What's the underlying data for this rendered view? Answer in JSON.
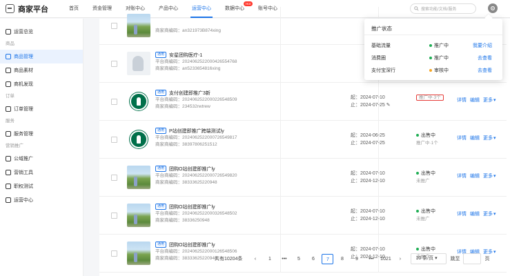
{
  "app": {
    "title": "商家平台"
  },
  "nav": [
    {
      "label": "首页",
      "active": false,
      "badge": ""
    },
    {
      "label": "资金管理",
      "active": false,
      "badge": ""
    },
    {
      "label": "对账中心",
      "active": false,
      "badge": ""
    },
    {
      "label": "产品中心",
      "active": false,
      "badge": ""
    },
    {
      "label": "运营中心",
      "active": true,
      "badge": ""
    },
    {
      "label": "数据中心",
      "active": false,
      "badge": "Hot"
    },
    {
      "label": "账号中心",
      "active": false,
      "badge": ""
    }
  ],
  "search": {
    "placeholder": "搜索功能/文档/服务"
  },
  "sidebar": {
    "items": [
      {
        "type": "item",
        "label": "运营总览",
        "active": false
      },
      {
        "type": "section",
        "label": "商品"
      },
      {
        "type": "item",
        "label": "商品管理",
        "active": true
      },
      {
        "type": "item",
        "label": "商品素材",
        "active": false
      },
      {
        "type": "item",
        "label": "商机发现",
        "active": false
      },
      {
        "type": "section",
        "label": "订单"
      },
      {
        "type": "item",
        "label": "订单管理",
        "active": false
      },
      {
        "type": "section",
        "label": "服务"
      },
      {
        "type": "item",
        "label": "服务管理",
        "active": false
      },
      {
        "type": "section",
        "label": "营销推广"
      },
      {
        "type": "item",
        "label": "公域推广",
        "active": false
      },
      {
        "type": "item",
        "label": "营销工具",
        "active": false
      },
      {
        "type": "item",
        "label": "职权测试",
        "active": false
      },
      {
        "type": "item",
        "label": "运营中心",
        "active": false
      }
    ]
  },
  "products": [
    {
      "img": "photo",
      "tag": "",
      "name": "",
      "id": "",
      "merchant_code": "商家商编码：an321973B874xing",
      "start": "",
      "end": "",
      "status": "",
      "status_sub": "",
      "highlight": false,
      "actions": []
    },
    {
      "img": "white",
      "tag": "通用",
      "name": "安星团购医疗-1",
      "id": "平台商编码：2024062522000426554768",
      "merchant_code": "商家商编码：an5233654816xing",
      "start": "",
      "end": "",
      "status": "",
      "status_sub": "",
      "highlight": false,
      "actions": []
    },
    {
      "img": "logo",
      "tag": "通用",
      "name": "支付创建即推广3新",
      "id": "平台商编码：2024062522000226548509",
      "merchant_code": "商家商编码：234532rwtrew",
      "start": "起：2024-07-10",
      "end": "止：2024-07-25",
      "status": "",
      "status_sub": "推广中·3个",
      "highlight": true,
      "actions": [
        "详情",
        "编辑",
        "更多"
      ]
    },
    {
      "img": "logo",
      "tag": "通用",
      "name": "P站创建即推广跨端测试ly",
      "id": "平台商编码：2024062522000726549817",
      "merchant_code": "商家商编码：38397806251512",
      "start": "起：2024-06-25",
      "end": "止：2024-07-25",
      "status": "出售中",
      "status_sub": "推广中·1个",
      "highlight": false,
      "actions": [
        "详情",
        "编辑",
        "更多"
      ]
    },
    {
      "img": "photo",
      "tag": "通用",
      "name": "团购O站创建即推广ly",
      "id": "平台商编码：2024062522000726549820",
      "merchant_code": "商家商编码：38333625220948",
      "start": "起：2024-07-10",
      "end": "止：2024-12-10",
      "status": "出售中",
      "status_sub": "未推广",
      "highlight": false,
      "actions": [
        "详情",
        "编辑",
        "更多"
      ]
    },
    {
      "img": "photo",
      "tag": "通用",
      "name": "团购O站创建即推广ly",
      "id": "平台商编码：2024062522000326548502",
      "merchant_code": "商家商编码：38336250948",
      "start": "起：2024-07-10",
      "end": "止：2024-12-10",
      "status": "出售中",
      "status_sub": "未推广",
      "highlight": false,
      "actions": [
        "详情",
        "编辑",
        "更多"
      ]
    },
    {
      "img": "photo",
      "tag": "通用",
      "name": "团购O站创建即推广ly",
      "id": "平台商编码：2024062522000126548506",
      "merchant_code": "商家商编码：38333625220948",
      "start": "起：2024-07-10",
      "end": "止：2024-12-10",
      "status": "出售中",
      "status_sub": "未推广",
      "highlight": false,
      "actions": [
        "详情",
        "编辑",
        "更多"
      ]
    }
  ],
  "popover": {
    "title": "推广状态",
    "rows": [
      {
        "channel": "基础流量",
        "status": "推广中",
        "status_color": "#1fae54",
        "link": "我要介绍"
      },
      {
        "channel": "消费圈",
        "status": "推广中",
        "status_color": "#1fae54",
        "link": "去查看"
      },
      {
        "channel": "支付宝深行",
        "status": "审核中",
        "status_color": "#f5a623",
        "link": "去查看"
      }
    ]
  },
  "pagination": {
    "total": "共有10204条",
    "pages": [
      "1",
      "•••",
      "5",
      "6",
      "7",
      "8",
      "9",
      "•••",
      "1021"
    ],
    "current": "7",
    "page_size": "10 条/页",
    "jump_label": "跳至",
    "page_unit": "页"
  }
}
